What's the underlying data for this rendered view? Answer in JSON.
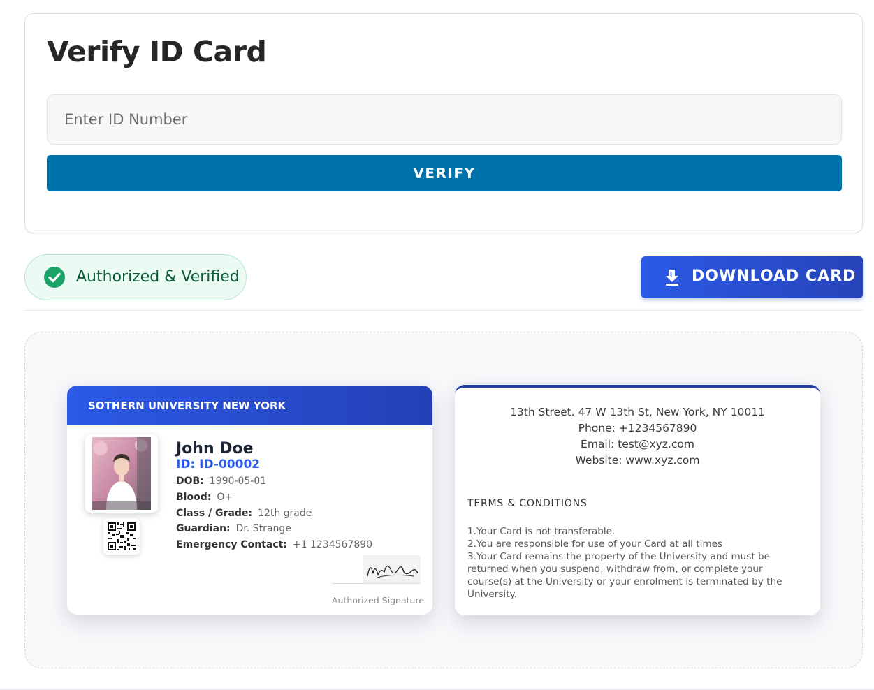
{
  "verify_form": {
    "title": "Verify ID Card",
    "input_placeholder": "Enter ID Number",
    "input_value": "",
    "verify_label": "VERIFY"
  },
  "status": {
    "label": "Authorized & Verified",
    "icon": "check-circle-icon",
    "color": "#1aa267"
  },
  "download": {
    "label": "DOWNLOAD CARD",
    "icon": "download-arrow-icon"
  },
  "card_front": {
    "university": "SOTHERN UNIVERSITY NEW YORK",
    "name": "John Doe",
    "id_label": "ID: ID-00002",
    "fields": [
      {
        "label": "DOB:",
        "value": "1990-05-01"
      },
      {
        "label": "Blood:",
        "value": "O+"
      },
      {
        "label": "Class / Grade:",
        "value": "12th grade"
      },
      {
        "label": "Guardian:",
        "value": "Dr. Strange"
      },
      {
        "label": "Emergency Contact:",
        "value": "+1 1234567890"
      }
    ],
    "signature_label": "Authorized Signature"
  },
  "card_back": {
    "address": "13th Street. 47 W 13th St, New York, NY 10011",
    "phone": "Phone: +1234567890",
    "email": "Email: test@xyz.com",
    "website": "Website: www.xyz.com",
    "terms_title": "TERMS & CONDITIONS",
    "terms": [
      "1.Your Card is not transferable.",
      "2.You are responsible for use of your Card at all times",
      "3.Your Card remains the property of the University and must be returned when you suspend, withdraw from, or complete your course(s) at the University or your enrolment is terminated by the University."
    ]
  },
  "colors": {
    "primary": "#0072ab",
    "accent": "#2b5ae6",
    "success_bg": "#ebfaf2"
  }
}
